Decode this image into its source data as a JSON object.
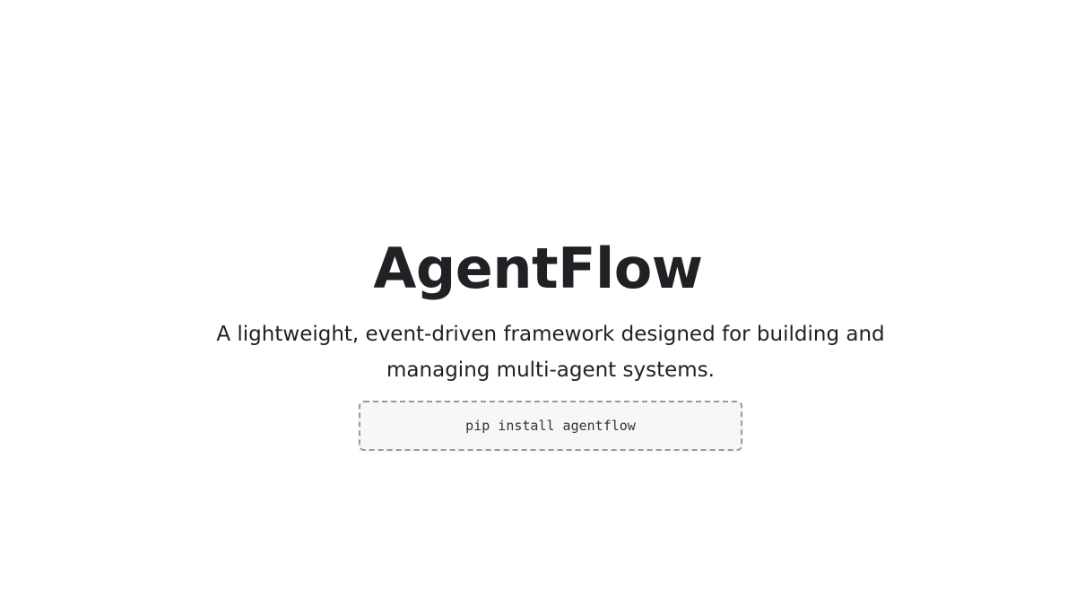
{
  "hero": {
    "title": "AgentFlow",
    "subtitle": "A lightweight, event-driven framework designed for building and managing multi-agent systems.",
    "install_command": "pip install agentflow"
  },
  "colors": {
    "background": "#ffffff",
    "text": "#202124",
    "code_background": "#f6f7f8",
    "code_border": "#9a9a9a"
  }
}
